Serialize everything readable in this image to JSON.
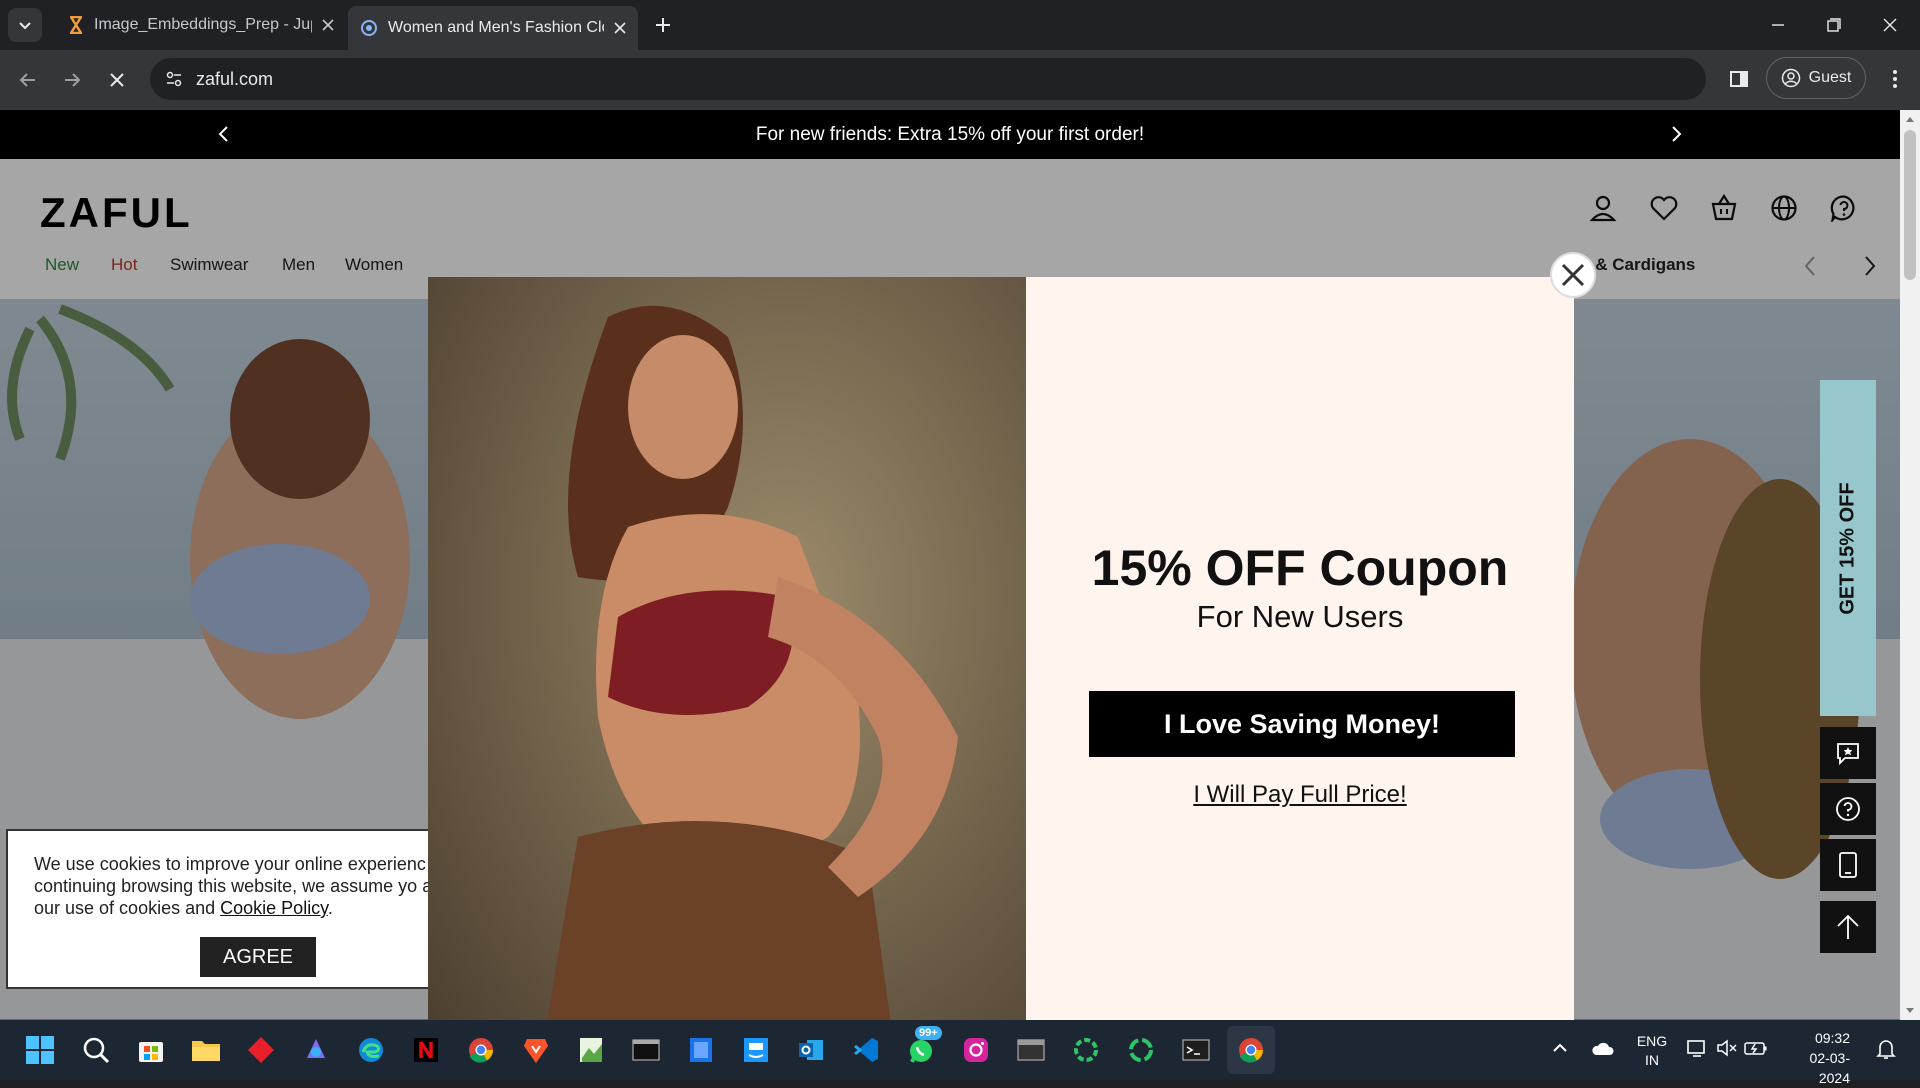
{
  "browser": {
    "tabs": [
      {
        "title": "Image_Embeddings_Prep - Jupy",
        "active": false
      },
      {
        "title": "Women and Men's Fashion Clot",
        "active": true
      }
    ],
    "url": "zaful.com",
    "profile_label": "Guest"
  },
  "page": {
    "promo_text": "For new friends: Extra 15% off your first order!",
    "logo": "ZAFUL",
    "nav": {
      "items": [
        "New",
        "Hot",
        "Swimwear",
        "Men",
        "Women"
      ],
      "partial_item": "ers & Cardigans",
      "colors": {
        "new": "#2a8a3a",
        "hot": "#c0392b"
      }
    },
    "modal": {
      "title": "15% OFF Coupon",
      "subtitle": "For New Users",
      "primary_button": "I Love Saving Money!",
      "secondary_link": "I Will Pay Full Price!",
      "background": "#fff4ee"
    },
    "cookie_banner": {
      "text": "We use cookies to improve your online experienc continuing browsing this website, we assume yo agree our use of cookies and",
      "link": "Cookie Policy",
      "button": "AGREE"
    },
    "side_tab": {
      "label": "GET 15% OFF",
      "color": "#97c7cc"
    }
  },
  "taskbar": {
    "language": "ENG",
    "region": "IN",
    "time": "09:32",
    "date": "02-03-2024",
    "whatsapp_badge": "99+"
  },
  "icons": [
    "start-icon",
    "search-icon",
    "store-icon",
    "file-explorer-icon",
    "app-icon",
    "copilot-icon",
    "edge-icon",
    "netflix-icon",
    "chrome-icon",
    "brave-icon",
    "photos-icon",
    "terminal-icon",
    "files-icon",
    "prime-video-icon",
    "outlook-icon",
    "vscode-icon",
    "whatsapp-icon",
    "instagram-icon",
    "window-icon",
    "circle-app-icon",
    "circle-app-icon",
    "terminal-icon",
    "chrome-icon"
  ]
}
